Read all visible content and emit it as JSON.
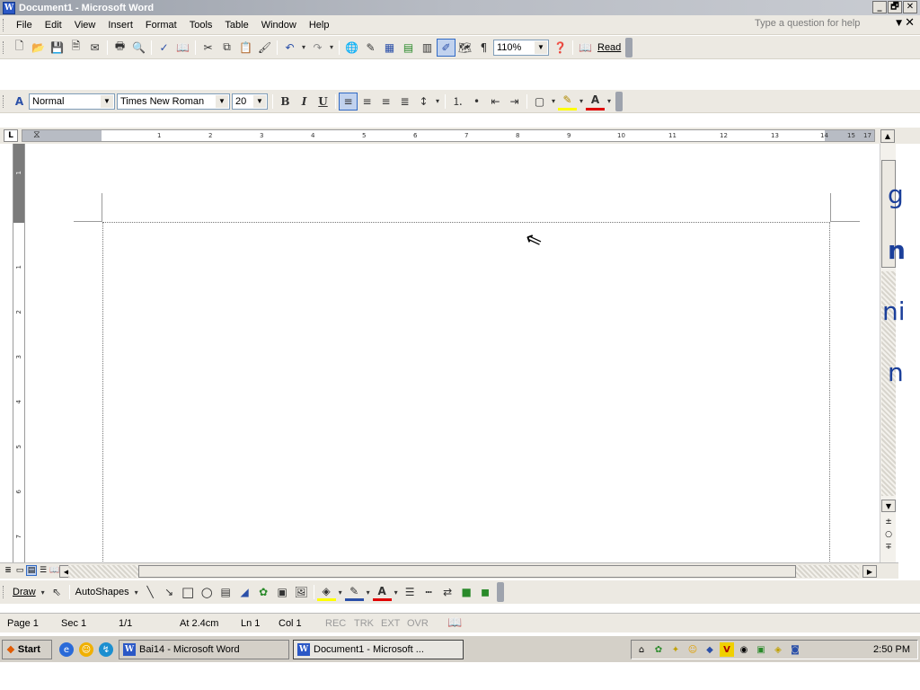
{
  "window": {
    "title": "Document1 - Microsoft Word",
    "app_icon": "W",
    "minimize": "_",
    "maximize": "🗗",
    "close": "✕"
  },
  "menu": {
    "items": [
      "File",
      "Edit",
      "View",
      "Insert",
      "Format",
      "Tools",
      "Table",
      "Window",
      "Help"
    ],
    "help_placeholder": "Type a question for help",
    "help_arrow": "▼",
    "doc_close": "✕"
  },
  "standard_toolbar": {
    "zoom": "110%",
    "read_label": "Read",
    "pilcrow": "¶"
  },
  "formatting_toolbar": {
    "style": "Normal",
    "font": "Times New Roman",
    "size": "20",
    "bold": "B",
    "italic": "I",
    "underline": "U",
    "font_color_glyph": "A"
  },
  "ruler": {
    "corner": "L",
    "ticks": [
      "1",
      "2",
      "3",
      "4",
      "5",
      "6",
      "7",
      "8",
      "9",
      "10",
      "11",
      "12",
      "13",
      "14",
      "15",
      "17"
    ],
    "vticks": [
      "1",
      "1",
      "2",
      "3",
      "4",
      "5",
      "6",
      "7"
    ]
  },
  "edge_text": [
    "g",
    "n",
    "ni",
    "n"
  ],
  "draw_toolbar": {
    "draw_label": "Draw",
    "autoshapes_label": "AutoShapes"
  },
  "status": {
    "page": "Page 1",
    "sec": "Sec 1",
    "pages": "1/1",
    "at": "At 2.4cm",
    "ln": "Ln 1",
    "col": "Col 1",
    "rec": "REC",
    "trk": "TRK",
    "ext": "EXT",
    "ovr": "OVR"
  },
  "taskbar": {
    "start_label": "Start",
    "tasks": [
      "Bai14 - Microsoft Word",
      "Document1 - Microsoft ..."
    ],
    "clock": "2:50 PM"
  }
}
